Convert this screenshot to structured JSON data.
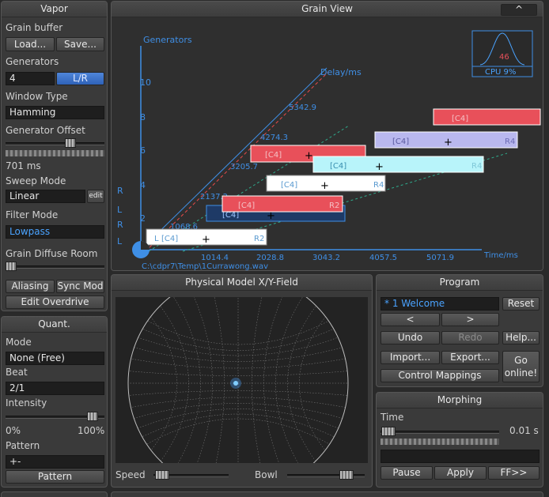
{
  "vapor": {
    "title": "Vapor",
    "grain_buffer_label": "Grain buffer",
    "load_label": "Load...",
    "save_label": "Save...",
    "generators_label": "Generators",
    "generators_value": "4",
    "lr_label": "L/R",
    "window_type_label": "Window Type",
    "window_type_value": "Hamming",
    "generator_offset_label": "Generator Offset",
    "generator_offset_value": "701 ms",
    "sweep_mode_label": "Sweep Mode",
    "sweep_mode_value": "Linear",
    "edit_label": "edit",
    "filter_mode_label": "Filter Mode",
    "filter_mode_value": "Lowpass",
    "diffuse_room_label": "Grain Diffuse Room",
    "aliasing_label": "Aliasing",
    "sync_mod_label": "Sync Mod",
    "edit_overdrive_label": "Edit Overdrive"
  },
  "quant": {
    "title": "Quant.",
    "mode_label": "Mode",
    "mode_value": "None (Free)",
    "beat_label": "Beat",
    "beat_value": "2/1",
    "intensity_label": "Intensity",
    "intensity_min": "0%",
    "intensity_max": "100%",
    "pattern_label": "Pattern",
    "pattern_value": "+-",
    "pattern_button": "Pattern"
  },
  "grain_view": {
    "title": "Grain View",
    "collapse_label": "^",
    "y_axis_label": "Generators",
    "y_ticks": [
      "2",
      "4",
      "6",
      "8",
      "10"
    ],
    "x_axis_label": "Time/ms",
    "x_ticks": [
      "1014.4",
      "2028.8",
      "3043.2",
      "4057.5",
      "5071.9"
    ],
    "delay_label": "Delay/ms",
    "delay_ticks": [
      "1068.6",
      "2137.2",
      "3205.7",
      "4274.3",
      "5342.9"
    ],
    "channel_labels": [
      "R",
      "L",
      "R",
      "L"
    ],
    "file_path": "C:\\cdpr7\\Temp\\1Currawong.wav",
    "cpu_value": "46",
    "cpu_label": "CPU 9%",
    "grain_tag": "[C4]",
    "grain_edge_left": "L",
    "grain_edge_right_r2": "R2",
    "grain_edge_right_r4": "R4"
  },
  "physical_model": {
    "title": "Physical Model X/Y-Field",
    "speed_label": "Speed",
    "bowl_label": "Bowl"
  },
  "program": {
    "title": "Program",
    "current": "* 1 Welcome",
    "reset_label": "Reset",
    "prev_label": "<",
    "next_label": ">",
    "undo_label": "Undo",
    "redo_label": "Redo",
    "help_label": "Help...",
    "import_label": "Import...",
    "export_label": "Export...",
    "go_online_label": "Go online!",
    "control_mappings_label": "Control Mappings"
  },
  "morphing": {
    "title": "Morphing",
    "time_label": "Time",
    "time_value": "0.01 s",
    "pause_label": "Pause",
    "apply_label": "Apply",
    "ff_label": "FF>>"
  },
  "colors": {
    "accent_blue": "#4aa3ff",
    "grain_red": "#e8505a",
    "grain_cyan": "#b8f4fa",
    "grain_lavender": "#b9b8ee"
  }
}
